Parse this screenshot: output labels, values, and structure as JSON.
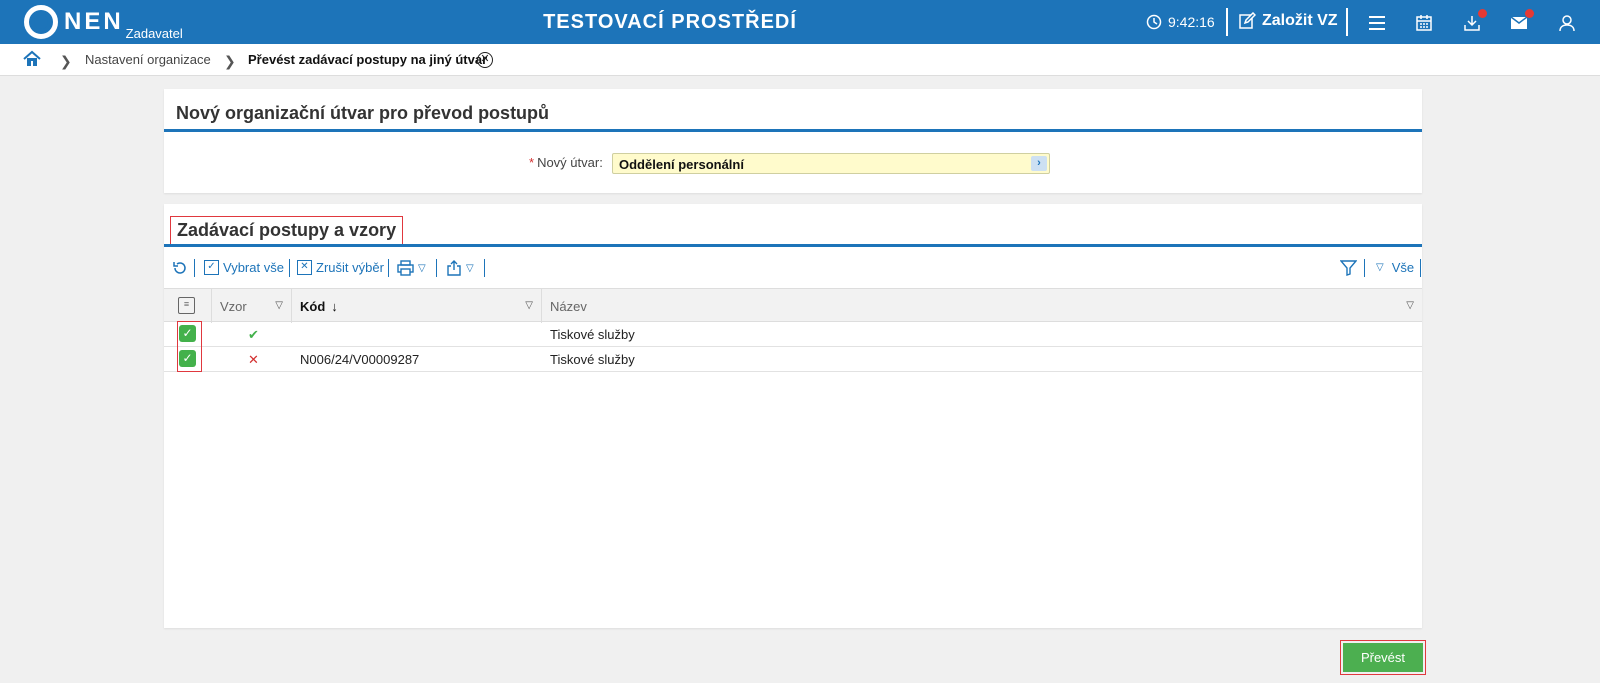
{
  "header": {
    "logo_text": "NEN",
    "logo_sub": "Zadavatel",
    "env_title": "TESTOVACÍ PROSTŘEDÍ",
    "time": "9:42:16",
    "create_label": "Založit VZ"
  },
  "breadcrumb": {
    "items": [
      "Nastavení organizace",
      "Převést zadávací postupy na jiný útvar"
    ]
  },
  "panel1": {
    "title": "Nový organizační útvar pro převod postupů",
    "field_label": "Nový útvar",
    "field_required": "*",
    "field_value": "Oddělení personální"
  },
  "panel2": {
    "title": "Zadávací postupy a vzory",
    "toolbar": {
      "select_all": "Vybrat vše",
      "deselect": "Zrušit výběr",
      "filter_all": "Vše"
    },
    "columns": {
      "vzor": "Vzor",
      "kod": "Kód",
      "nazev": "Název"
    },
    "rows": [
      {
        "checked": true,
        "vzor": "yes",
        "kod": "",
        "nazev": "Tiskové služby"
      },
      {
        "checked": true,
        "vzor": "no",
        "kod": "N006/24/V00009287",
        "nazev": "Tiskové služby"
      }
    ]
  },
  "actions": {
    "submit_label": "Převést"
  },
  "colors": {
    "brand": "#1d74b9",
    "success": "#43b14b",
    "error": "#d32f2f",
    "highlight": "#e0383e"
  }
}
